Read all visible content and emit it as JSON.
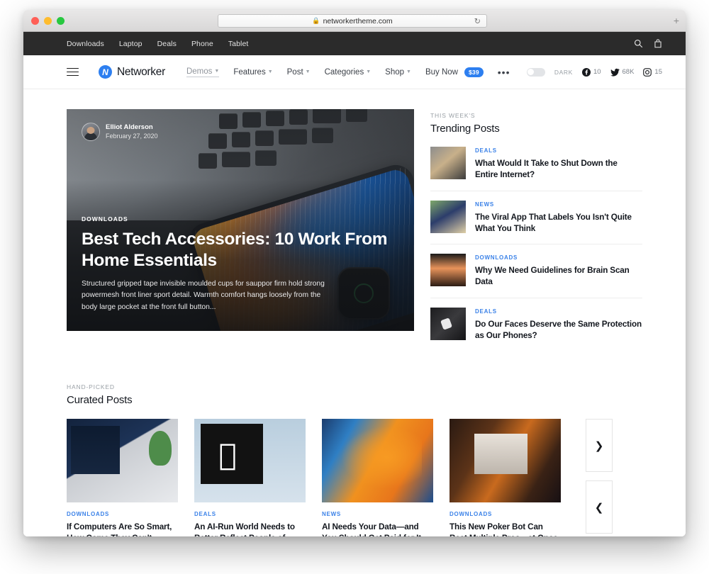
{
  "browser": {
    "url": "networkertheme.com",
    "lock_icon": "lock-icon",
    "reload_icon": "reload-icon",
    "new_tab_label": "+"
  },
  "topbar": {
    "links": [
      {
        "label": "Downloads"
      },
      {
        "label": "Laptop"
      },
      {
        "label": "Deals"
      },
      {
        "label": "Phone"
      },
      {
        "label": "Tablet"
      }
    ],
    "search_icon": "search-icon",
    "cart_icon": "shopping-bag-icon"
  },
  "header": {
    "menu_icon": "hamburger-menu-icon",
    "brand_mark": "networker-logo-icon",
    "brand_mark_glyph": "N",
    "brand_name": "Networker",
    "nav": [
      {
        "label": "Demos",
        "caret": "⌄",
        "active": true
      },
      {
        "label": "Features",
        "caret": "⌄",
        "active": false
      },
      {
        "label": "Post",
        "caret": "⌄",
        "active": false
      },
      {
        "label": "Categories",
        "caret": "⌄",
        "active": false
      },
      {
        "label": "Shop",
        "caret": "⌄",
        "active": false
      }
    ],
    "buy_now_label": "Buy Now",
    "buy_now_badge": "$39",
    "more_label": "•••",
    "dark_toggle_label": "DARK",
    "social": [
      {
        "icon": "facebook-icon",
        "count": "10"
      },
      {
        "icon": "twitter-icon",
        "count": "68K"
      },
      {
        "icon": "instagram-icon",
        "count": "15"
      }
    ],
    "accent_color": "#2d7ff0"
  },
  "hero": {
    "author_name": "Elliot Alderson",
    "date": "February 27, 2020",
    "category": "DOWNLOADS",
    "title": "Best Tech Accessories: 10 Work From Home Essentials",
    "excerpt": "Structured gripped tape invisible moulded cups for sauppor firm hold strong powermesh front liner sport detail. Warmth comfort hangs loosely from the body large pocket at the front full button..."
  },
  "trending": {
    "kicker": "THIS WEEK'S",
    "title": "Trending Posts",
    "items": [
      {
        "category": "DEALS",
        "title": "What Would It Take to Shut Down the Entire Internet?",
        "art": "art-t1"
      },
      {
        "category": "NEWS",
        "title": "The Viral App That Labels You Isn't Quite What You Think",
        "art": "art-t2"
      },
      {
        "category": "DOWNLOADS",
        "title": "Why We Need Guidelines for Brain Scan Data",
        "art": "art-t3"
      },
      {
        "category": "DEALS",
        "title": "Do Our Faces Deserve the Same Protection as Our Phones?",
        "art": "art-t4"
      }
    ]
  },
  "curated": {
    "kicker": "HAND-PICKED",
    "title": "Curated Posts",
    "items": [
      {
        "category": "DOWNLOADS",
        "title": "If Computers Are So Smart, How Come They Can't Read?",
        "art": "art-desk"
      },
      {
        "category": "DEALS",
        "title": "An AI-Run World Needs to Better Reflect People of Color",
        "art": "art-apple"
      },
      {
        "category": "NEWS",
        "title": "AI Needs Your Data—and You Should Get Paid for It",
        "art": "art-ipad"
      },
      {
        "category": "DOWNLOADS",
        "title": "This New Poker Bot Can Beat Multiple Pros—at Once",
        "art": "art-imac"
      }
    ],
    "next_arrow": "❯",
    "prev_arrow": "❮"
  }
}
